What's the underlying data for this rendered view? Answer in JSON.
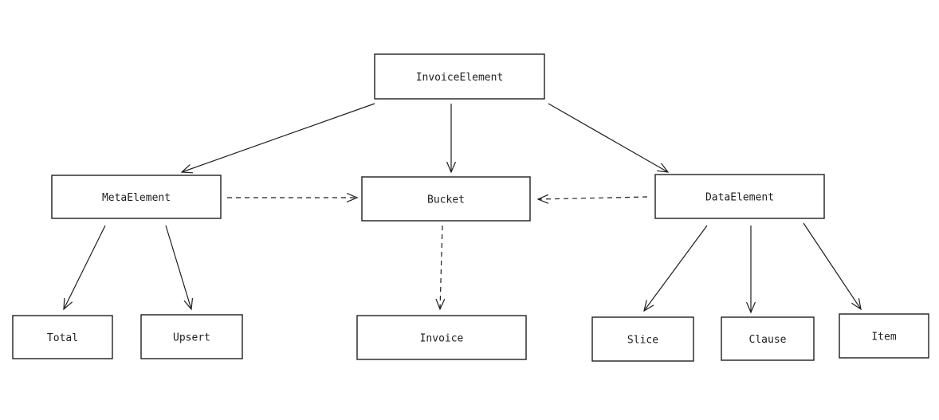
{
  "diagram": {
    "nodes": [
      {
        "id": "invoice_element",
        "label": "InvoiceElement"
      },
      {
        "id": "meta_element",
        "label": "MetaElement"
      },
      {
        "id": "bucket",
        "label": "Bucket"
      },
      {
        "id": "data_element",
        "label": "DataElement"
      },
      {
        "id": "total",
        "label": "Total"
      },
      {
        "id": "upsert",
        "label": "Upsert"
      },
      {
        "id": "invoice",
        "label": "Invoice"
      },
      {
        "id": "slice",
        "label": "Slice"
      },
      {
        "id": "clause",
        "label": "Clause"
      },
      {
        "id": "item",
        "label": "Item"
      }
    ],
    "edges": [
      {
        "from": "invoice_element",
        "to": "meta_element",
        "style": "solid"
      },
      {
        "from": "invoice_element",
        "to": "bucket",
        "style": "solid"
      },
      {
        "from": "invoice_element",
        "to": "data_element",
        "style": "solid"
      },
      {
        "from": "meta_element",
        "to": "bucket",
        "style": "dashed"
      },
      {
        "from": "data_element",
        "to": "bucket",
        "style": "dashed"
      },
      {
        "from": "meta_element",
        "to": "total",
        "style": "solid"
      },
      {
        "from": "meta_element",
        "to": "upsert",
        "style": "solid"
      },
      {
        "from": "bucket",
        "to": "invoice",
        "style": "dashed"
      },
      {
        "from": "data_element",
        "to": "slice",
        "style": "solid"
      },
      {
        "from": "data_element",
        "to": "clause",
        "style": "solid"
      },
      {
        "from": "data_element",
        "to": "item",
        "style": "solid"
      }
    ]
  }
}
